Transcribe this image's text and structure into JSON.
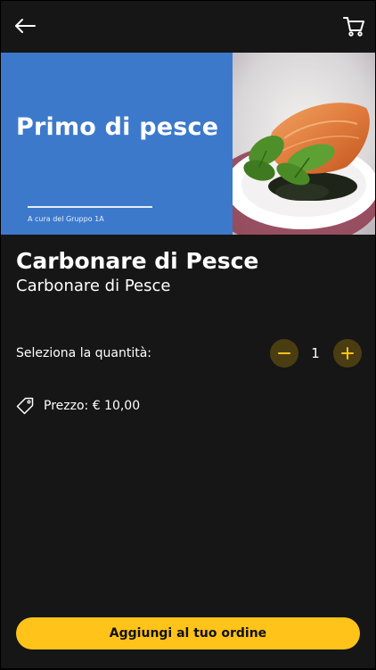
{
  "header": {
    "back_icon": "arrow-left-icon",
    "cart_icon": "shopping-cart-icon"
  },
  "hero": {
    "title": "Primo di pesce",
    "credit": "A cura del Gruppo 1A",
    "left_color": "#3d79cb"
  },
  "dish": {
    "title": "Carbonare di Pesce",
    "subtitle": "Carbonare di Pesce"
  },
  "quantity": {
    "label": "Seleziona la quantità:",
    "value": "1",
    "minus_icon": "minus-icon",
    "plus_icon": "plus-icon"
  },
  "price": {
    "icon": "price-tag-icon",
    "text": "Prezzo:  € 10,00"
  },
  "cta": {
    "label": "Aggiungi al tuo ordine"
  },
  "colors": {
    "background": "#161616",
    "accent": "#ffc31a",
    "stepper_bg": "#4a3d12"
  }
}
